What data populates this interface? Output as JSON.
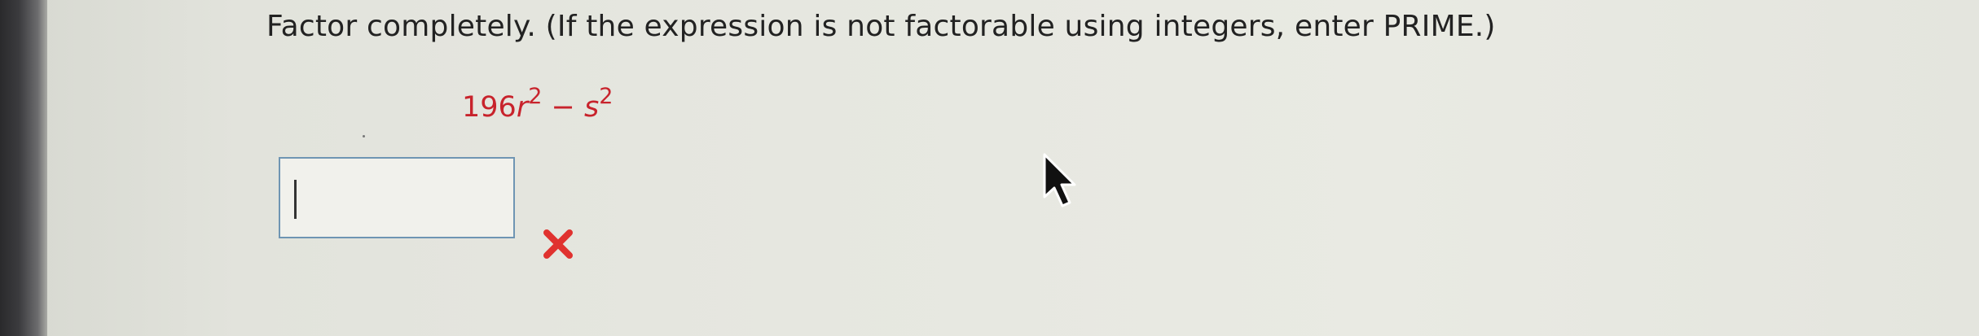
{
  "question": {
    "prompt": "Factor completely. (If the expression is not factorable using integers, enter PRIME.)"
  },
  "expression": {
    "coefficient": "196",
    "var1": "r",
    "exp1": "2",
    "operator": "−",
    "var2": "s",
    "exp2": "2"
  },
  "answer": {
    "value": ""
  },
  "feedback": {
    "status": "incorrect",
    "icon": "x-mark-icon",
    "color": "#e0322f"
  },
  "colors": {
    "expression": "#c8232c",
    "input_border": "#6f95b3"
  }
}
